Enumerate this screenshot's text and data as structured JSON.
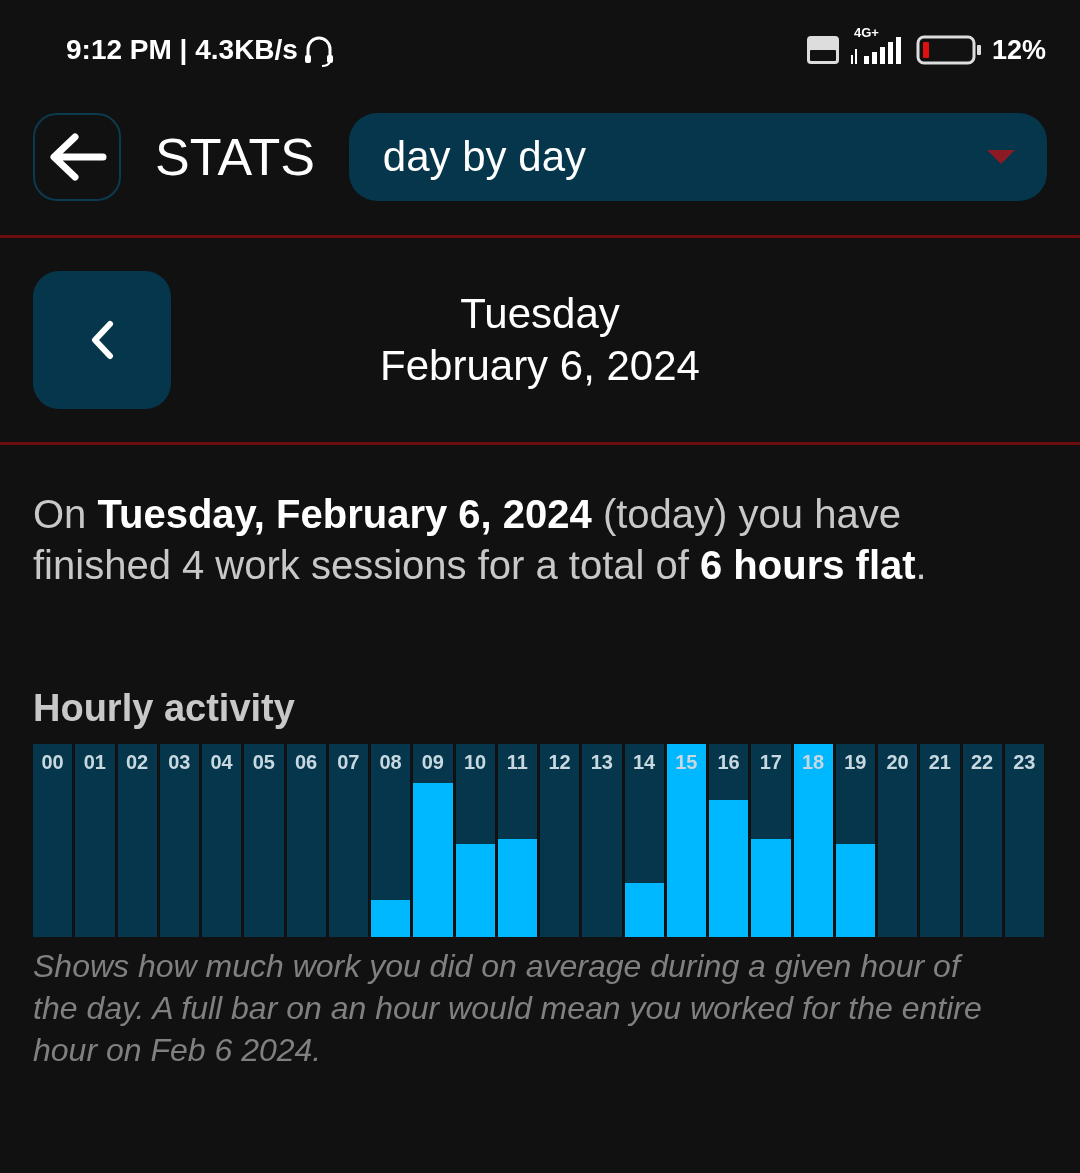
{
  "status_bar": {
    "time": "9:12 PM | 4.3KB/s",
    "network": "4G+",
    "battery": "12%"
  },
  "header": {
    "title": "STATS",
    "dropdown": {
      "value": "day by day"
    }
  },
  "date_nav": {
    "weekday": "Tuesday",
    "date": "February 6, 2024"
  },
  "summary": "On **Tuesday, February 6, 2024** (today) you have finished 4 work sessions for a total of **6 hours flat**.",
  "hourly_activity": {
    "title": "Hourly activity",
    "hours": [
      {
        "label": "00"
      },
      {
        "label": "01"
      },
      {
        "label": "02"
      },
      {
        "label": "03"
      },
      {
        "label": "04"
      },
      {
        "label": "05"
      },
      {
        "label": "06"
      },
      {
        "label": "07"
      },
      {
        "label": "08",
        "level": 0.19
      },
      {
        "label": "09",
        "level": 0.8
      },
      {
        "label": "10",
        "level": 0.48
      },
      {
        "label": "11",
        "level": 0.51
      },
      {
        "label": "12"
      },
      {
        "label": "13"
      },
      {
        "label": "14",
        "level": 0.28
      },
      {
        "label": "15",
        "level": 1
      },
      {
        "label": "16",
        "level": 0.71
      },
      {
        "label": "17",
        "level": 0.51
      },
      {
        "label": "18",
        "level": 1
      },
      {
        "label": "19",
        "level": 0.48
      },
      {
        "label": "20"
      },
      {
        "label": "21"
      },
      {
        "label": "22"
      },
      {
        "label": "23"
      }
    ],
    "caption": "Shows how much work you did on average during a given hour of the day. A full bar on an hour would mean you worked for the entire hour on Feb 6 2024."
  }
}
